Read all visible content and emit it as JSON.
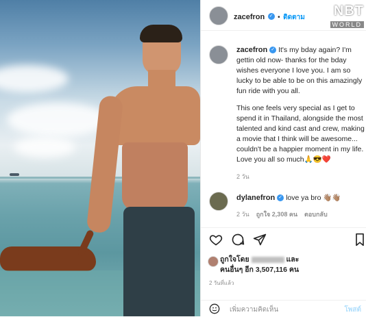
{
  "watermark": {
    "brand": "NBT",
    "sub": "WORLD"
  },
  "post_header": {
    "username": "zacefron",
    "follow_label": "ติดตาม",
    "separator": "•"
  },
  "caption": {
    "username": "zacefron",
    "paragraph1": "It's my bday again? I'm gettin old now- thanks for the bday wishes everyone I love you. I am so lucky to be able to be on this amazingly fun ride with you all.",
    "paragraph2": "This one feels very special as I get to spend it in Thailand, alongside the most talented and kind cast and crew, making a movie that I think will be awesome... couldn't be a happier moment in my life. Love you all so much🙏😎❤️",
    "time": "2 วัน"
  },
  "comment": {
    "username": "dylanefron",
    "text": "love ya bro 👋🏽👋🏽",
    "time": "2 วัน",
    "likes": "ถูกใจ 2,308 คน",
    "reply": "ตอบกลับ"
  },
  "likes": {
    "liked_by": "ถูกใจโดย",
    "and": "และ",
    "others": "คนอื่นๆ อีก 3,507,116 คน",
    "date": "2 วันที่แล้ว"
  },
  "footer": {
    "placeholder": "เพิ่มความคิดเห็น",
    "post": "โพสต์"
  },
  "colors": {
    "link": "#0095f6",
    "verified": "#3897f0",
    "heart": "#ed4956"
  }
}
